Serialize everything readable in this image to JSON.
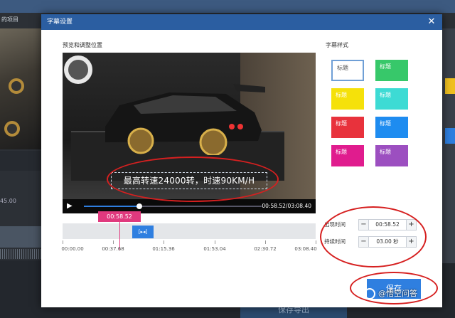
{
  "background_app": {
    "tab_label": "的项目",
    "left_time": "45.00",
    "save_export_label": "保存导出"
  },
  "dialog": {
    "title": "字幕设置",
    "close_glyph": "✕",
    "preview_label": "预览和调整位置",
    "subtitle_text": "最高转速24000转，时速90KM/H",
    "player": {
      "play_glyph": "▶",
      "time_display": "00:58.52/03:08.40",
      "progress_fraction": 0.31
    },
    "styles": {
      "label": "字幕样式",
      "items": [
        {
          "label": "标题",
          "color": "#ffffff",
          "selected": true
        },
        {
          "label": "标题",
          "color": "#37c86a",
          "selected": false
        },
        {
          "label": "标题",
          "color": "#f5e10a",
          "selected": false
        },
        {
          "label": "标题",
          "color": "#3ddbd4",
          "selected": false
        },
        {
          "label": "标题",
          "color": "#e8323c",
          "selected": false
        },
        {
          "label": "标题",
          "color": "#1e8cf0",
          "selected": false
        },
        {
          "label": "标题",
          "color": "#e01c8e",
          "selected": false
        },
        {
          "label": "标题",
          "color": "#9c4fc0",
          "selected": false
        }
      ]
    },
    "timeline": {
      "marker_time": "00:58.52",
      "clip_label": "[▸◂]",
      "ticks": [
        "00:00.00",
        "00:37.68",
        "01:15.36",
        "01:53.04",
        "02:30.72",
        "03:08.40"
      ]
    },
    "fields": {
      "appear_label": "出现时间",
      "appear_value": "00:58.52",
      "duration_label": "持续时间",
      "duration_value": "03.00 秒",
      "minus_glyph": "−",
      "plus_glyph": "+"
    },
    "save_label": "保存"
  },
  "watermark": {
    "text": "@悟空问答"
  },
  "colors": {
    "title_bar": "#2b5ea1",
    "accent": "#2f7fe0",
    "marker": "#e0397e",
    "annotation": "#d62020"
  }
}
